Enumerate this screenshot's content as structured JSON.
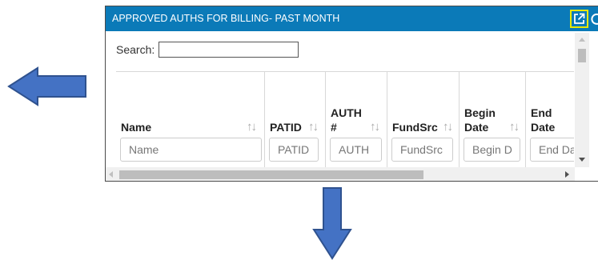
{
  "panel": {
    "title": "APPROVED AUTHS FOR BILLING- PAST MONTH",
    "search_label": "Search:",
    "search_value": "",
    "title_bg_color": "#0b7ab8",
    "highlight_color": "#e8e800"
  },
  "columns": [
    {
      "header_line1": "",
      "header_line2": "Name",
      "filter_placeholder": "Name",
      "sort_icon": "sort-arrows-icon"
    },
    {
      "header_line1": "",
      "header_line2": "PATID",
      "filter_placeholder": "PATID",
      "sort_icon": "sort-arrows-icon"
    },
    {
      "header_line1": "AUTH",
      "header_line2": "#",
      "filter_placeholder": "AUTH",
      "sort_icon": "sort-arrows-icon"
    },
    {
      "header_line1": "",
      "header_line2": "FundSrc",
      "filter_placeholder": "FundSrc",
      "sort_icon": "sort-arrows-icon"
    },
    {
      "header_line1": "Begin",
      "header_line2": "Date",
      "filter_placeholder": "Begin D",
      "sort_icon": "sort-arrows-icon"
    },
    {
      "header_line1": "End",
      "header_line2": "Date",
      "filter_placeholder": "End Da",
      "sort_icon": "sort-arrows-icon"
    }
  ],
  "icons": {
    "popout": "external-link-icon",
    "refresh": "refresh-icon",
    "left_arrow": "left-arrow-icon",
    "down_arrow": "down-arrow-icon"
  },
  "arrow_color": "#4472c4"
}
